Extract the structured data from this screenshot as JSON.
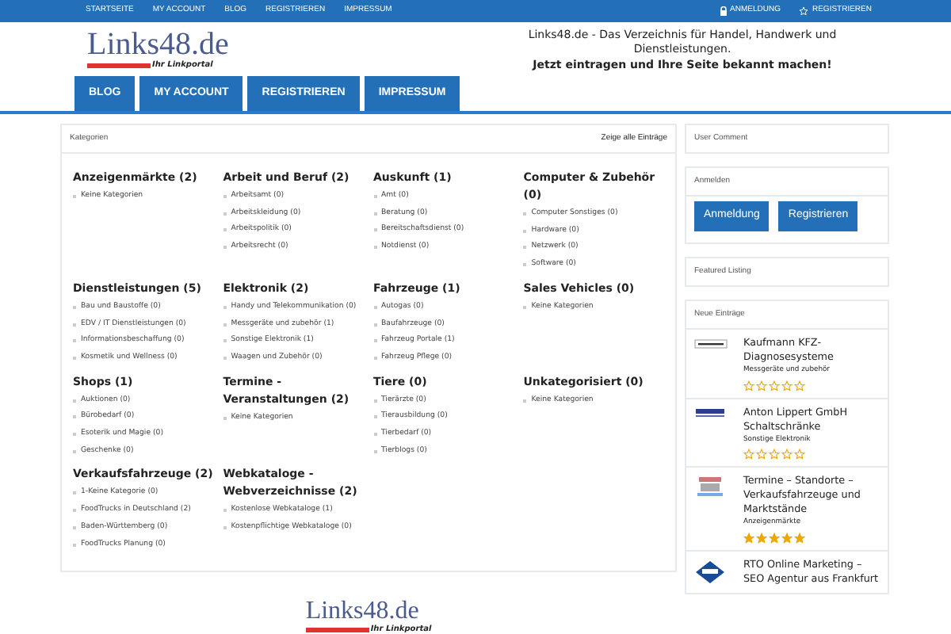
{
  "top_links": [
    "STARTSEITE",
    "MY ACCOUNT",
    "BLOG",
    "REGISTRIEREN",
    "IMPRESSUM"
  ],
  "top_right": [
    {
      "kind": "lock",
      "label": "ANMELDUNG"
    },
    {
      "kind": "star",
      "label": "REGISTRIEREN"
    }
  ],
  "logo": {
    "title": "Links48.de",
    "subtitle": "Ihr Linkportal"
  },
  "tagline": {
    "text": "Links48.de - Das Verzeichnis für Handel, Handwerk und Dienstleistungen.",
    "emphasis": "Jetzt eintragen und Ihre Seite bekannt machen!"
  },
  "nav": [
    {
      "label": "BLOG",
      "selected": false
    },
    {
      "label": "MY ACCOUNT",
      "selected": false
    },
    {
      "label": "REGISTRIEREN",
      "selected": false
    },
    {
      "label": "IMPRESSUM",
      "selected": false
    }
  ],
  "categories_panel": {
    "title": "Kategorien",
    "show_all": "Zeige alle Einträge",
    "groups": [
      {
        "name": "Anzeigenmärkte (2)",
        "items": [
          "Keine Kategorien"
        ]
      },
      {
        "name": "Arbeit und Beruf (2)",
        "items": [
          "Arbeitsamt (0)",
          "Arbeitskleidung (0)",
          "Arbeitspolitik (0)",
          "Arbeitsrecht (0)"
        ]
      },
      {
        "name": "Auskunft (1)",
        "items": [
          "Amt (0)",
          "Beratung (0)",
          "Bereitschaftsdienst (0)",
          "Notdienst (0)"
        ]
      },
      {
        "name": "Computer & Zubehör (0)",
        "items": [
          "Computer Sonstiges (0)",
          "Hardware (0)",
          "Netzwerk (0)",
          "Software (0)"
        ]
      },
      {
        "name": "Dienstleistungen (5)",
        "items": [
          "Bau und Baustoffe (0)",
          "EDV / IT Dienstleistungen (0)",
          "Informationsbeschaffung (0)",
          "Kosmetik und Wellness (0)"
        ]
      },
      {
        "name": "Elektronik (2)",
        "items": [
          "Handy und Telekommunikation (0)",
          "Messgeräte und zubehör (1)",
          "Sonstige Elektronik (1)",
          "Waagen und Zubehör (0)"
        ]
      },
      {
        "name": "Fahrzeuge (1)",
        "items": [
          "Autogas (0)",
          "Baufahrzeuge (0)",
          "Fahrzeug Portale (1)",
          "Fahrzeug Pflege (0)"
        ]
      },
      {
        "name": "Sales Vehicles (0)",
        "items": [
          "Keine Kategorien"
        ]
      },
      {
        "name": "Shops (1)",
        "items": [
          "Auktionen (0)",
          "Bürobedarf (0)",
          "Esoterik und Magie (0)",
          "Geschenke (0)"
        ]
      },
      {
        "name": "Termine - Veranstaltungen (2)",
        "items": [
          "Keine Kategorien"
        ]
      },
      {
        "name": "Tiere (0)",
        "items": [
          "Tierärzte (0)",
          "Tierausbildung (0)",
          "Tierbedarf (0)",
          "Tierblogs (0)"
        ]
      },
      {
        "name": "Unkategorisiert (0)",
        "items": [
          "Keine Kategorien"
        ]
      },
      {
        "name": "Verkaufsfahrzeuge (2)",
        "items": [
          "1-Keine Kategorie (0)",
          "FoodTrucks in Deutschland (2)",
          "Baden-Württemberg (0)",
          "FoodTrucks Planung (0)"
        ]
      },
      {
        "name": "Webkataloge - Webverzeichnisse (2)",
        "items": [
          "Kostenlose Webkataloge (1)",
          "Kostenpflichtige Webkataloge (0)"
        ]
      }
    ]
  },
  "sidebar": [
    {
      "kind": "title",
      "title": "User Comment"
    },
    {
      "kind": "buttons",
      "title": "Anmelden",
      "buttons": [
        "Anmeldung",
        "Registrieren"
      ]
    },
    {
      "kind": "title",
      "title": "Featured Listing"
    },
    {
      "kind": "entries",
      "title": "Neue Einträge",
      "entries": [
        {
          "kind": "bar",
          "title": "Kaufmann KFZ-Diagnosesysteme",
          "category": "Messgeräte und zubehör",
          "stars": 0
        },
        {
          "kind": "stripes",
          "title": "Anton Lippert GmbH Schaltschränke",
          "category": "Sonstige Elektronik",
          "stars": 0
        },
        {
          "kind": "truck",
          "title": "Termine – Standorte – Verkaufsfahrzeuge und Marktstände",
          "category": "Anzeigenmärkte",
          "stars": 5
        },
        {
          "kind": "diamond",
          "title": "RTO Online Marketing – SEO Agentur aus Frankfurt"
        }
      ]
    }
  ],
  "footer_logo": {
    "title": "Links48.de",
    "subtitle": "Ihr Linkportal"
  }
}
